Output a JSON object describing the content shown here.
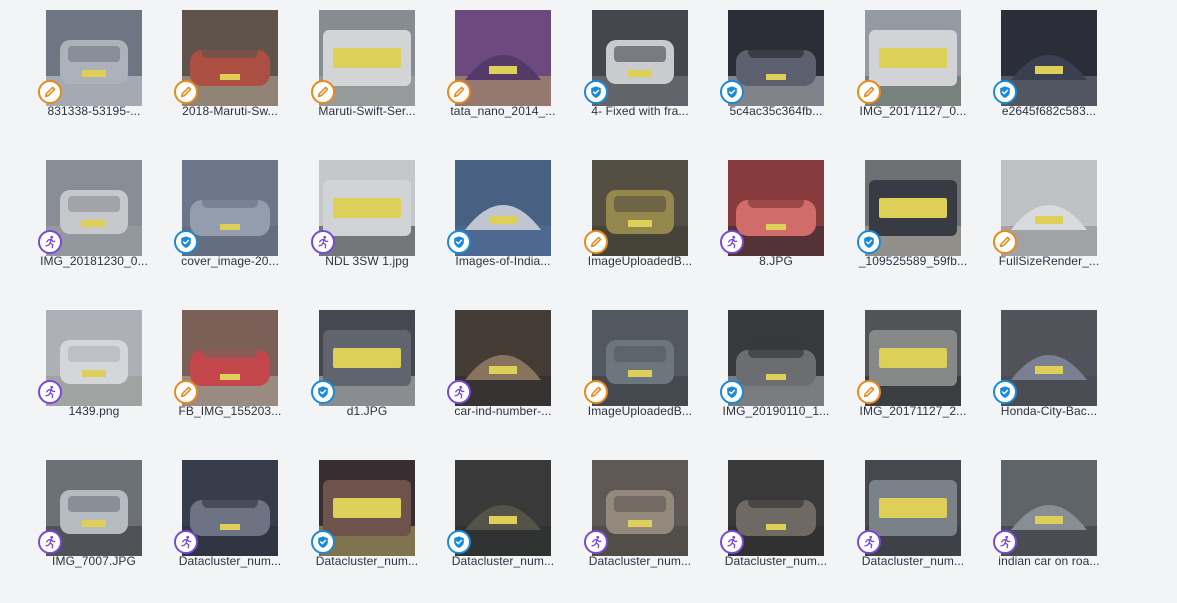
{
  "colors": {
    "pending": "#e8891b",
    "verified": "#1a8ad6",
    "running": "#7b48d6",
    "background": "#f3f4f6",
    "plate": "#f3e14a"
  },
  "status_icons": {
    "pending": "pencil-icon",
    "verified": "shield-check-icon",
    "running": "running-person-icon"
  },
  "files": [
    {
      "label": "831338-53195-...",
      "status": "pending"
    },
    {
      "label": "2018-Maruti-Sw...",
      "status": "pending"
    },
    {
      "label": "Maruti-Swift-Ser...",
      "status": "pending"
    },
    {
      "label": "tata_nano_2014_...",
      "status": "pending"
    },
    {
      "label": "4- Fixed with fra...",
      "status": "verified"
    },
    {
      "label": "5c4ac35c364fb...",
      "status": "verified"
    },
    {
      "label": "IMG_20171127_0...",
      "status": "pending"
    },
    {
      "label": "e2645f682c583...",
      "status": "verified"
    },
    {
      "label": "IMG_20181230_0...",
      "status": "running"
    },
    {
      "label": "cover_image-20...",
      "status": "verified"
    },
    {
      "label": "NDL 3SW 1.jpg",
      "status": "running"
    },
    {
      "label": "Images-of-India...",
      "status": "verified"
    },
    {
      "label": "ImageUploadedB...",
      "status": "pending"
    },
    {
      "label": "8.JPG",
      "status": "running"
    },
    {
      "label": "_109525589_59fb...",
      "status": "verified"
    },
    {
      "label": "FullSizeRender_...",
      "status": "pending"
    },
    {
      "label": "1439.png",
      "status": "running"
    },
    {
      "label": "FB_IMG_155203...",
      "status": "pending"
    },
    {
      "label": "d1.JPG",
      "status": "verified"
    },
    {
      "label": "car-ind-number-...",
      "status": "running"
    },
    {
      "label": "ImageUploadedB...",
      "status": "pending"
    },
    {
      "label": "IMG_20190110_1...",
      "status": "verified"
    },
    {
      "label": "IMG_20171127_2...",
      "status": "pending"
    },
    {
      "label": "Honda-City-Bac...",
      "status": "verified"
    },
    {
      "label": "IMG_7007.JPG",
      "status": "running"
    },
    {
      "label": "Datacluster_num...",
      "status": "running"
    },
    {
      "label": "Datacluster_num...",
      "status": "verified"
    },
    {
      "label": "Datacluster_num...",
      "status": "verified"
    },
    {
      "label": "Datacluster_num...",
      "status": "running"
    },
    {
      "label": "Datacluster_num...",
      "status": "running"
    },
    {
      "label": "Datacluster_num...",
      "status": "running"
    },
    {
      "label": "indian car on roa...",
      "status": "running"
    }
  ]
}
